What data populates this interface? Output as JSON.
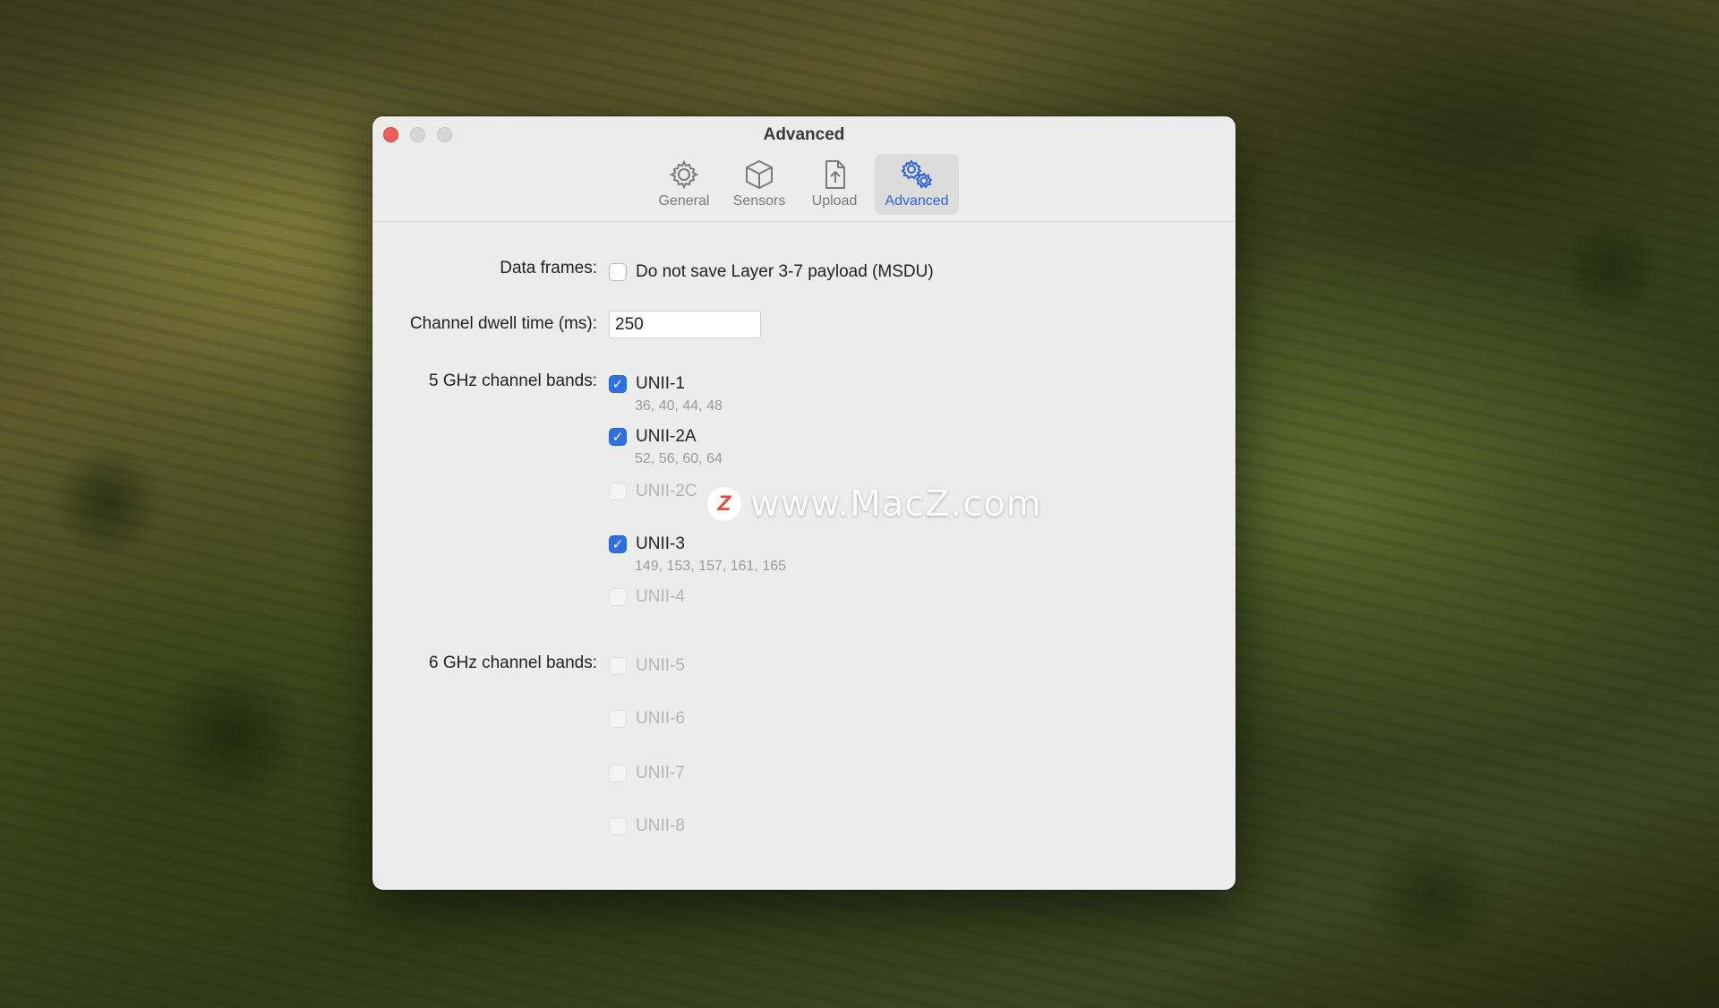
{
  "window": {
    "title": "Advanced",
    "tabs": [
      {
        "label": "General",
        "icon": "gear-icon",
        "active": false
      },
      {
        "label": "Sensors",
        "icon": "cube-icon",
        "active": false
      },
      {
        "label": "Upload",
        "icon": "upload-icon",
        "active": false
      },
      {
        "label": "Advanced",
        "icon": "gears-icon",
        "active": true
      }
    ]
  },
  "settings": {
    "data_frames": {
      "label": "Data frames:",
      "option": "Do not save Layer 3-7 payload (MSDU)",
      "checked": false
    },
    "dwell": {
      "label": "Channel dwell time (ms):",
      "value": "250"
    },
    "bands5": {
      "label": "5 GHz channel bands:",
      "items": [
        {
          "name": "UNII-1",
          "channels": "36, 40, 44, 48",
          "checked": true,
          "enabled": true
        },
        {
          "name": "UNII-2A",
          "channels": "52, 56, 60, 64",
          "checked": true,
          "enabled": true
        },
        {
          "name": "UNII-2C",
          "channels": "",
          "checked": false,
          "enabled": false
        },
        {
          "name": "UNII-3",
          "channels": "149, 153, 157, 161, 165",
          "checked": true,
          "enabled": true
        },
        {
          "name": "UNII-4",
          "channels": "",
          "checked": false,
          "enabled": false
        }
      ]
    },
    "bands6": {
      "label": "6 GHz channel bands:",
      "items": [
        {
          "name": "UNII-5",
          "checked": false,
          "enabled": false
        },
        {
          "name": "UNII-6",
          "checked": false,
          "enabled": false
        },
        {
          "name": "UNII-7",
          "checked": false,
          "enabled": false
        },
        {
          "name": "UNII-8",
          "checked": false,
          "enabled": false
        }
      ]
    }
  },
  "watermark": {
    "badge": "Z",
    "text": "www.MacZ.com"
  },
  "colors": {
    "accent": "#2f6fe0",
    "close": "#ee5f58"
  }
}
